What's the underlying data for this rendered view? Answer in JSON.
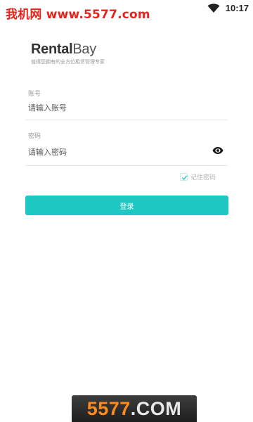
{
  "status_bar": {
    "watermark": "我机网 www.5577.com",
    "time": "10:17",
    "wifi_icon": "wifi-icon"
  },
  "brand": {
    "logo_strong": "Rental",
    "logo_light": "Bay",
    "slogan": "值得您拥有的全方位租赁管理专家"
  },
  "form": {
    "account_label": "账号",
    "account_placeholder": "请输入账号",
    "account_value": "",
    "password_label": "密码",
    "password_placeholder": "请输入密码",
    "password_value": "",
    "toggle_visibility_icon": "eye-icon",
    "remember_label": "记住密码",
    "remember_checked": true,
    "login_label": "登录",
    "accent_color": "#1fc7c2"
  },
  "watermark_bottom": {
    "digits": "5577",
    "suffix": ".COM"
  }
}
